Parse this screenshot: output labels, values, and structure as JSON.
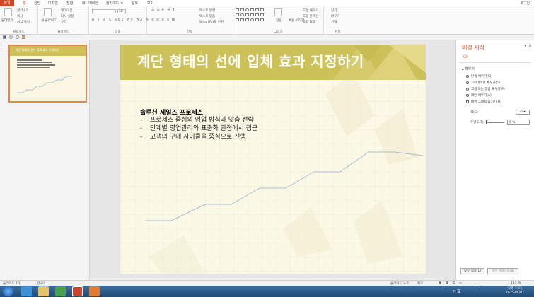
{
  "tabs": [
    "파일",
    "홈",
    "삽입",
    "디자인",
    "전환",
    "애니메이션",
    "슬라이드 쇼",
    "검토",
    "보기"
  ],
  "login": "로그인",
  "ribbon": {
    "clipboard": {
      "paste": "붙여넣기",
      "cut": "잘라내기",
      "copy": "복사",
      "format_painter": "서식 복사",
      "label": "클립보드"
    },
    "slides": {
      "new_slide": "새 슬라이드",
      "layout": "레이아웃",
      "reset": "다시 설정",
      "section": "구역",
      "label": "슬라이드"
    },
    "font": {
      "font_name": "",
      "font_size": "18",
      "label": "글꼴"
    },
    "paragraph": {
      "text_direction": "텍스트 방향",
      "align_text": "텍스트 맞춤",
      "smartart": "SmartArt로 변환",
      "label": "단락"
    },
    "drawing": {
      "arrange": "정렬",
      "quick_styles": "빠른 스타일",
      "shape_fill": "도형 채우기",
      "shape_outline": "도형 윤곽선",
      "shape_effects": "도형 효과",
      "label": "그리기"
    },
    "editing": {
      "find": "찾기",
      "replace": "바꾸기",
      "select": "선택",
      "label": "편집"
    }
  },
  "thumbnail": {
    "number": "1",
    "title": "계단 형태의 선에 입체 효과 지정하기"
  },
  "slide": {
    "title": "계단 형태의 선에 입체 효과 지정하기",
    "heading": "솔루션 세일즈 프로세스",
    "bullets": [
      {
        "dash": "-",
        "text": "프로세스 중심의 영업 방식과 맞춤 전략"
      },
      {
        "dash": "-",
        "text": "단계별 영업관리와 표준화 관점에서 접근"
      },
      {
        "dash": "-",
        "text": "고객의 구매 사이클을 중심으로 진행"
      }
    ],
    "line_color": "#a9bfd8",
    "header_color": "#cdc25a"
  },
  "format_pane": {
    "title": "배경 서식",
    "section": "채우기",
    "options": [
      {
        "label": "단색 채우기(S)",
        "type": "radio",
        "selected": true
      },
      {
        "label": "그라데이션 채우기(G)",
        "type": "radio",
        "selected": false
      },
      {
        "label": "그림 또는 질감 채우기(P)",
        "type": "radio",
        "selected": false
      },
      {
        "label": "패턴 채우기(A)",
        "type": "radio",
        "selected": false
      },
      {
        "label": "배경 그래픽 숨기기(H)",
        "type": "check",
        "selected": false
      }
    ],
    "color_label": "색(C)",
    "transparency_label": "투명도(T)",
    "transparency_value": "0 %",
    "apply_all": "모두 적용(L)",
    "reset_background": "배경 원래대로(B)"
  },
  "status": {
    "slide": "슬라이드 1/1",
    "language": "한국어",
    "notes": "슬라이드 노트",
    "comments": "메모",
    "zoom": "115 %"
  },
  "taskbar": {
    "time": "오후 3:23",
    "date": "2015-04-07",
    "ime": "가 漢"
  }
}
